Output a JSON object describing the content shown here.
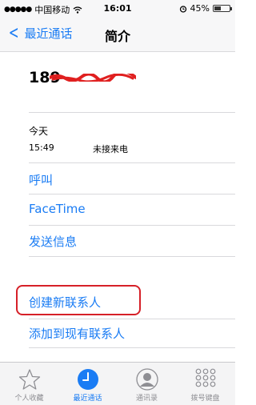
{
  "status_bar": {
    "carrier": "中国移动",
    "time": "16:01",
    "battery": "45%",
    "battery_level": 0.45
  },
  "nav": {
    "back_label": "最近通话",
    "title": "简介"
  },
  "contact": {
    "number_prefix": "189"
  },
  "call_log": {
    "date": "今天",
    "time": "15:49",
    "status": "未接来电"
  },
  "actions": {
    "call": "呼叫",
    "facetime": "FaceTime",
    "message": "发送信息",
    "create_contact": "创建新联系人",
    "add_existing": "添加到现有联系人"
  },
  "tabs": [
    {
      "label": "个人收藏",
      "icon": "star-icon"
    },
    {
      "label": "最近通话",
      "icon": "clock-icon",
      "active": true
    },
    {
      "label": "通讯录",
      "icon": "contacts-icon"
    },
    {
      "label": "拨号键盘",
      "icon": "keypad-icon"
    }
  ],
  "colors": {
    "accent": "#1a7cf4",
    "highlight": "#d62028",
    "redaction": "#e02020"
  }
}
